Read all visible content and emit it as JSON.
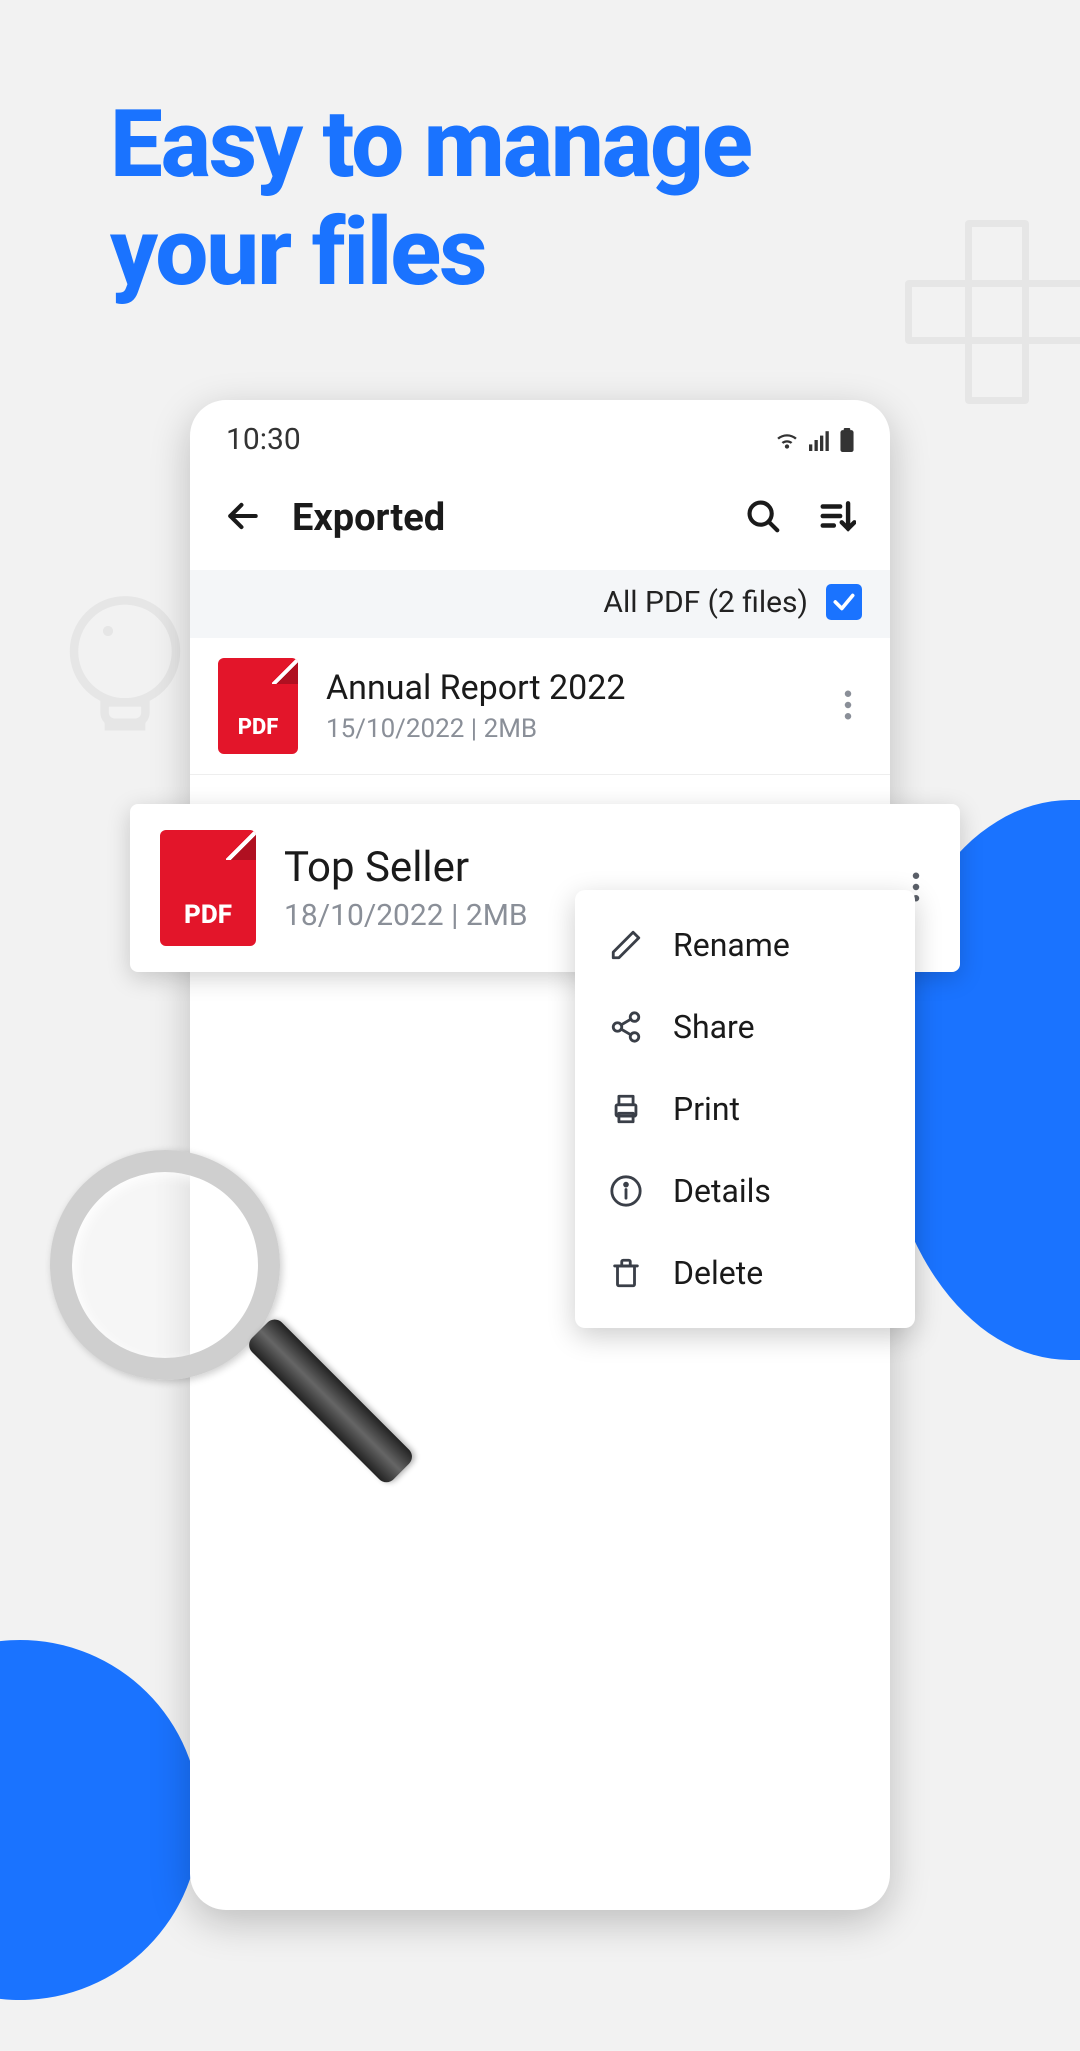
{
  "hero": {
    "line1": "Easy to manage",
    "line2": "your files"
  },
  "statusbar": {
    "time": "10:30"
  },
  "appbar": {
    "title": "Exported"
  },
  "select": {
    "label": "All PDF (2 files)",
    "checked": true
  },
  "files": [
    {
      "name": "Annual Report 2022",
      "meta": "15/10/2022 | 2MB"
    },
    {
      "name": "Top Seller",
      "meta": "18/10/2022 | 2MB"
    }
  ],
  "pdf_label": "PDF",
  "menu": {
    "rename": "Rename",
    "share": "Share",
    "print": "Print",
    "details": "Details",
    "delete": "Delete"
  }
}
